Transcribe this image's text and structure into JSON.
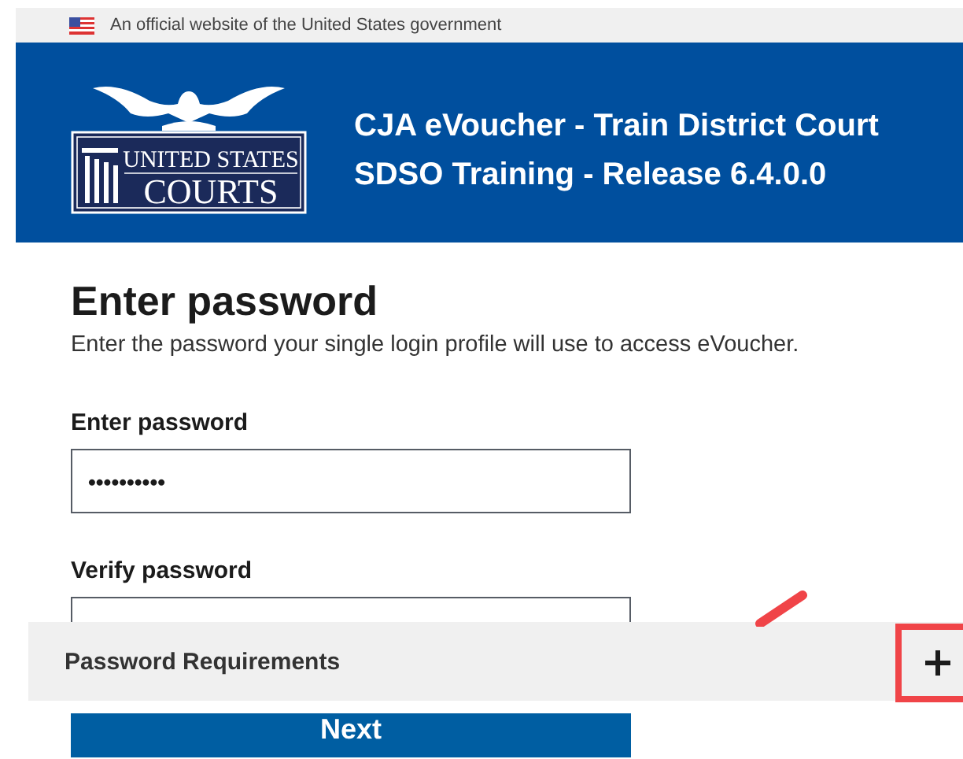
{
  "gov_banner": {
    "text": "An official website of the United States government"
  },
  "header": {
    "logo": {
      "line_1": "UNITED STATES",
      "line_2": "COURTS"
    },
    "title_lines": [
      "CJA eVoucher - Train District Court",
      "SDSO Training - Release 6.4.0.0"
    ]
  },
  "form": {
    "heading": "Enter password",
    "description": "Enter the password your single login profile will use to access eVoucher.",
    "fields": [
      {
        "label": "Enter password",
        "value": "••••••••••"
      },
      {
        "label": "Verify password"
      }
    ],
    "submit": "Next"
  },
  "accordion": {
    "title": "Password Requirements",
    "expanded": false,
    "highlighted": true
  }
}
